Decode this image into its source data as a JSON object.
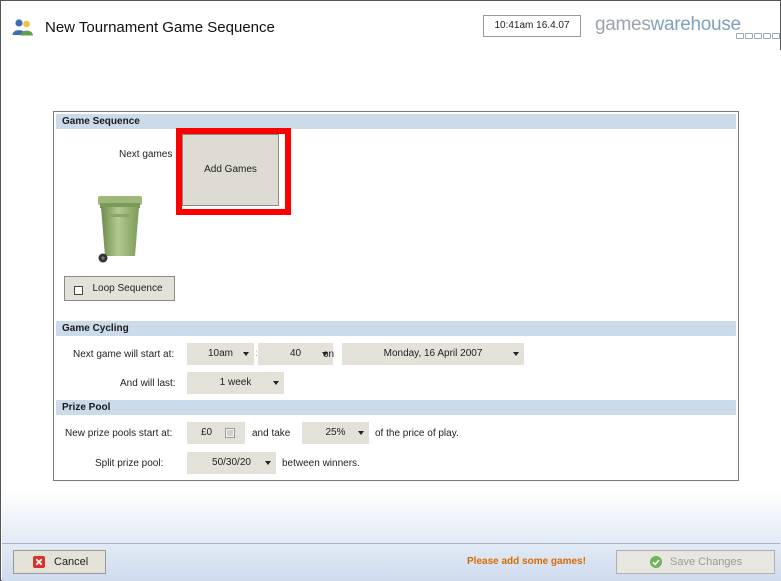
{
  "header": {
    "title": "New Tournament Game Sequence",
    "time": "10:41am 16.4.07",
    "logo_part1": "games",
    "logo_part2": "warehouse"
  },
  "game_sequence": {
    "section_title": "Game Sequence",
    "next_games_label": "Next games",
    "add_games_label": "Add Games",
    "loop_sequence_label": "Loop Sequence",
    "loop_sequence_checked": false
  },
  "game_cycling": {
    "section_title": "Game Cycling",
    "start_label": "Next game will start at:",
    "hour_value": "10am",
    "time_separator": ":",
    "minute_value": "40",
    "on_label": "on",
    "date_value": "Monday, 16 April 2007",
    "last_label": "And will last:",
    "duration_value": "1 week"
  },
  "prize_pool": {
    "section_title": "Prize Pool",
    "start_label": "New prize pools start at:",
    "amount_value": "£0",
    "take_label": "and take",
    "percent_value": "25%",
    "price_label": "of the price of play.",
    "split_label": "Split prize pool:",
    "split_value": "50/30/20",
    "between_label": "between winners."
  },
  "footer": {
    "cancel_label": "Cancel",
    "warning": "Please add some games!",
    "save_label": "Save Changes",
    "warning_color": "#d86a00"
  }
}
